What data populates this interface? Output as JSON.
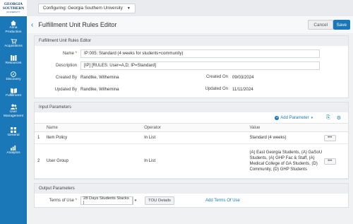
{
  "sidebar": {
    "logo": {
      "line1": "GEORGIA",
      "line2": "SOUTHERN",
      "line3": "UNIVERSITY"
    },
    "items": [
      {
        "label": "Alma Production",
        "icon": "home-icon"
      },
      {
        "label": "Acquisitions",
        "icon": "cart-icon"
      },
      {
        "label": "Resources",
        "icon": "library-icon"
      },
      {
        "label": "Discovery",
        "icon": "compass-icon"
      },
      {
        "label": "Fulfillment",
        "icon": "book-icon"
      },
      {
        "label": "User Management",
        "icon": "users-icon"
      },
      {
        "label": "General",
        "icon": "grid-icon"
      },
      {
        "label": "Analytics",
        "icon": "chart-icon"
      }
    ]
  },
  "topbar": {
    "config_label": "Configuring:",
    "config_value": "Georgia Southern University"
  },
  "header": {
    "title": "Fulfillment Unit Rules Editor",
    "cancel_label": "Cancel",
    "save_label": "Save"
  },
  "editor_section": {
    "title": "Fulfillment Unit Rules Editor",
    "name_label": "Name",
    "name_value": "IP:005: Standard (4 weeks for students+community)",
    "description_label": "Description",
    "description_value": "[IP] [RULES: User=A,D; IP=Standard]",
    "created_by_label": "Created By",
    "created_by_value": "Randtke, Wilhemina",
    "created_on_label": "Created On",
    "created_on_value": "09/03/2024",
    "updated_by_label": "Updated By",
    "updated_by_value": "Randtke, Wilhemina",
    "updated_on_label": "Updated On",
    "updated_on_value": "11/11/2024"
  },
  "input_section": {
    "title": "Input Parameters",
    "add_parameter_label": "Add Parameter",
    "columns": {
      "name": "Name",
      "operator": "Operator",
      "value": "Value"
    },
    "rows": [
      {
        "num": "1",
        "name": "Item Policy",
        "operator": "In List",
        "value": "Standard (4 weeks)"
      },
      {
        "num": "2",
        "name": "User Group",
        "operator": "In List",
        "value": "(A) East Georgia Students, (A) GaSoU Students, (A) GHP Fac & Staff, (A) Medical College of GA Students, (D) Community, (D) GHP Students"
      }
    ]
  },
  "output_section": {
    "title": "Output Parameters",
    "terms_label": "Terms of Use",
    "terms_value": "28 Days Students Stacks |",
    "tou_details_label": "TOU Details",
    "add_terms_label": "Add Terms Of Use"
  }
}
